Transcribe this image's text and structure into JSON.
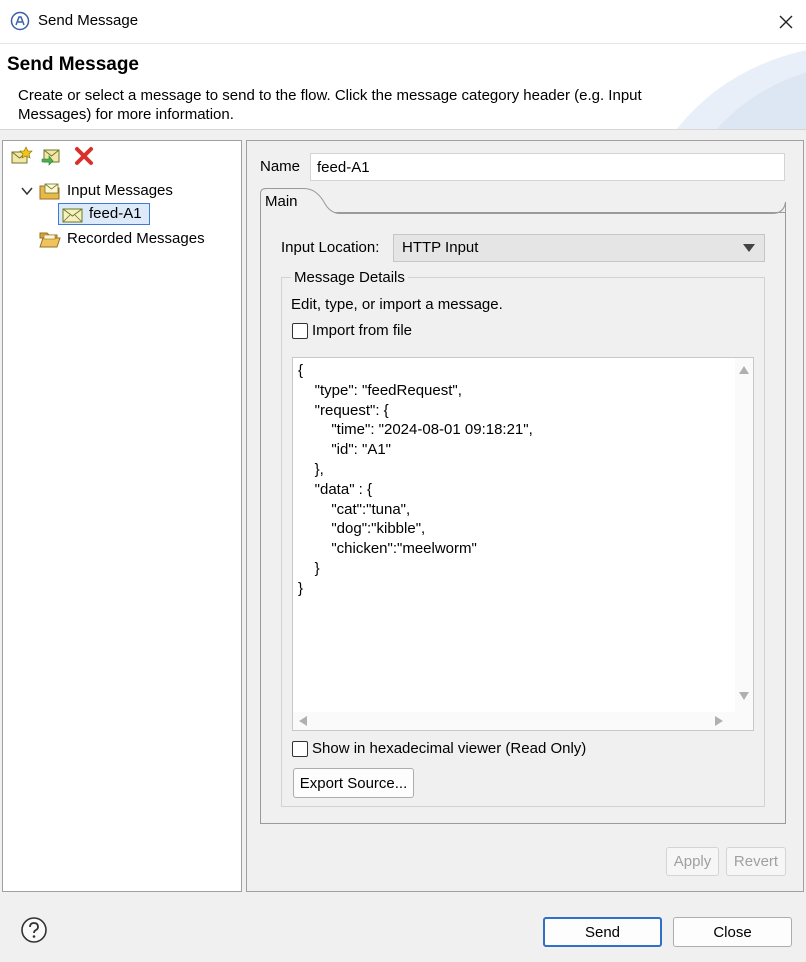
{
  "window": {
    "title": "Send Message"
  },
  "header": {
    "title": "Send Message",
    "description": "Create or select a message to send to the flow. Click the message category header (e.g. Input Messages) for more information."
  },
  "toolbar": {
    "icons": [
      "new-message-icon",
      "import-message-icon",
      "delete-icon"
    ]
  },
  "tree": {
    "items": [
      {
        "label": "Input Messages",
        "icon": "folder-message-icon",
        "expanded": true
      },
      {
        "label": "feed-A1",
        "icon": "envelope-icon",
        "selected": true
      },
      {
        "label": "Recorded Messages",
        "icon": "folder-open-icon"
      }
    ]
  },
  "form": {
    "name_label": "Name",
    "name_value": "feed-A1",
    "tab_main": "Main",
    "input_location_label": "Input Location:",
    "input_location_value": "HTTP Input",
    "details_legend": "Message Details",
    "details_hint": "Edit, type, or import a message.",
    "import_label": "Import from file",
    "import_checked": false,
    "message_body": "{\n    \"type\": \"feedRequest\",\n    \"request\": {\n        \"time\": \"2024-08-01 09:18:21\",\n        \"id\": \"A1\"\n    },\n    \"data\" : {\n        \"cat\":\"tuna\",\n        \"dog\":\"kibble\",\n        \"chicken\":\"meelworm\"\n    }\n}",
    "hex_label": "Show in hexadecimal viewer (Read Only)",
    "hex_checked": false,
    "export_label": "Export Source...",
    "apply_label": "Apply",
    "revert_label": "Revert"
  },
  "footer": {
    "send_label": "Send",
    "close_label": "Close"
  },
  "colors": {
    "accent": "#2f6ec9",
    "delete": "#d9302c",
    "folder": "#e8b84a"
  }
}
